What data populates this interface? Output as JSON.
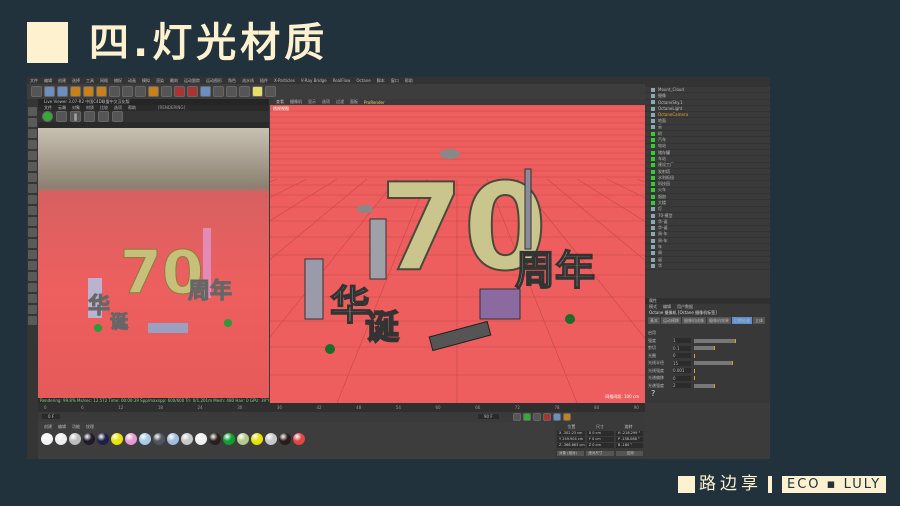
{
  "slide": {
    "title": "四.灯光材质",
    "footer_name": "路边享",
    "footer_brand": "ECO ▪ LULY"
  },
  "menu": [
    "文件",
    "编辑",
    "创建",
    "选择",
    "工具",
    "网格",
    "捕捉",
    "动画",
    "模拟",
    "渲染",
    "雕刻",
    "运动跟踪",
    "运动图形",
    "角色",
    "流水线",
    "插件",
    "X-Particles",
    "V-Ray Bridge",
    "RealFlow",
    "Octane",
    "脚本",
    "窗口",
    "帮助"
  ],
  "live_viewer": {
    "title": "Live Viewer 3.07-R2 中国C4D联盟中文汉化版",
    "menu": [
      "文件",
      "云端",
      "对象",
      "材质",
      "比较",
      "选项",
      "帮助"
    ],
    "state": "[RENDERING]",
    "status": "Rendering: 99.8%  Ms/sec: 12.572  Time: 00:00:39  Spp/maxspp: 600/600  Tri: 0/1.201m  Mesh: 480  Hair: 0  GPU: 39°C"
  },
  "viewport": {
    "menu": [
      "查看",
      "摄像机",
      "显示",
      "选项",
      "过滤",
      "面板",
      "ProRender"
    ],
    "label": "透视视图",
    "grid_label": "网格间距: 100 cm"
  },
  "objects": [
    "Mount_Cloud",
    "摄像",
    "OctaneSky.1",
    "OctaneLight",
    "OctaneCamera",
    "地面",
    "云",
    "树",
    "汽车",
    "电站",
    "储存罐",
    "车站",
    "建设工厂",
    "发射塔",
    "水利枢纽",
    "科技园",
    "火车",
    "烟囱",
    "大楼",
    "灯",
    "70-模型",
    "华-诞",
    "华-诞",
    "周-年",
    "周-年",
    "年",
    "周",
    "诞",
    "华"
  ],
  "attributes": {
    "header": "属性",
    "tabs": [
      "模式",
      "编辑",
      "用户数据"
    ],
    "object": "Octane 摄像机 [Octane 摄像机标签]",
    "subtabs": [
      "基本",
      "运动模糊",
      "摄像机成像",
      "摄像机效果",
      "后期处理",
      "立体"
    ],
    "rows": [
      {
        "label": "启用",
        "value": ""
      },
      {
        "label": "强度",
        "value": "1",
        "pct": 0.6
      },
      {
        "label": "剪切",
        "value": "0.1",
        "pct": 0.3
      },
      {
        "label": "光圈",
        "value": "0",
        "pct": 0
      },
      {
        "label": "光线半径",
        "value": "15",
        "pct": 0.55
      },
      {
        "label": "光线强度",
        "value": "0.001",
        "pct": 0.01
      },
      {
        "label": "光谱偏移",
        "value": "0",
        "pct": 0
      },
      {
        "label": "光谱强度",
        "value": "2",
        "pct": 0.3
      }
    ]
  },
  "timeline": {
    "ticks": [
      "0",
      "6",
      "12",
      "18",
      "24",
      "30",
      "36",
      "42",
      "48",
      "54",
      "60",
      "66",
      "72",
      "78",
      "84",
      "90"
    ],
    "frame": "0 F",
    "end": "90 F"
  },
  "materials": {
    "menu": [
      "创建",
      "编辑",
      "功能",
      "纹理"
    ],
    "colors": [
      "#f4f4f4",
      "#eeeeee",
      "#bdbdbd",
      "#1f1a2a",
      "#1d1f45",
      "#e8e400",
      "#e89ad0",
      "#a9cbe8",
      "#4d5560",
      "#a4bce0",
      "#c8c8c8",
      "#f0f0f0",
      "#2a1f1f",
      "#0ea030",
      "#b5c98a",
      "#e6e200",
      "#c9c9c9",
      "#2a1c1c",
      "#e24545"
    ]
  },
  "coords": {
    "headers": [
      "位置",
      "尺寸",
      "旋转"
    ],
    "pos": [
      "X -302.23 cm",
      "Y 249.904 cm",
      "Z -366.663 cm"
    ],
    "size": [
      "X 0 cm",
      "Y 0 cm",
      "Z 0 cm"
    ],
    "rot": [
      "H -218.299 °",
      "P -158.068 °",
      "B -180 °"
    ],
    "mode": "对象 (相对)",
    "size_mode": "绝对尺寸",
    "apply": "应用"
  }
}
